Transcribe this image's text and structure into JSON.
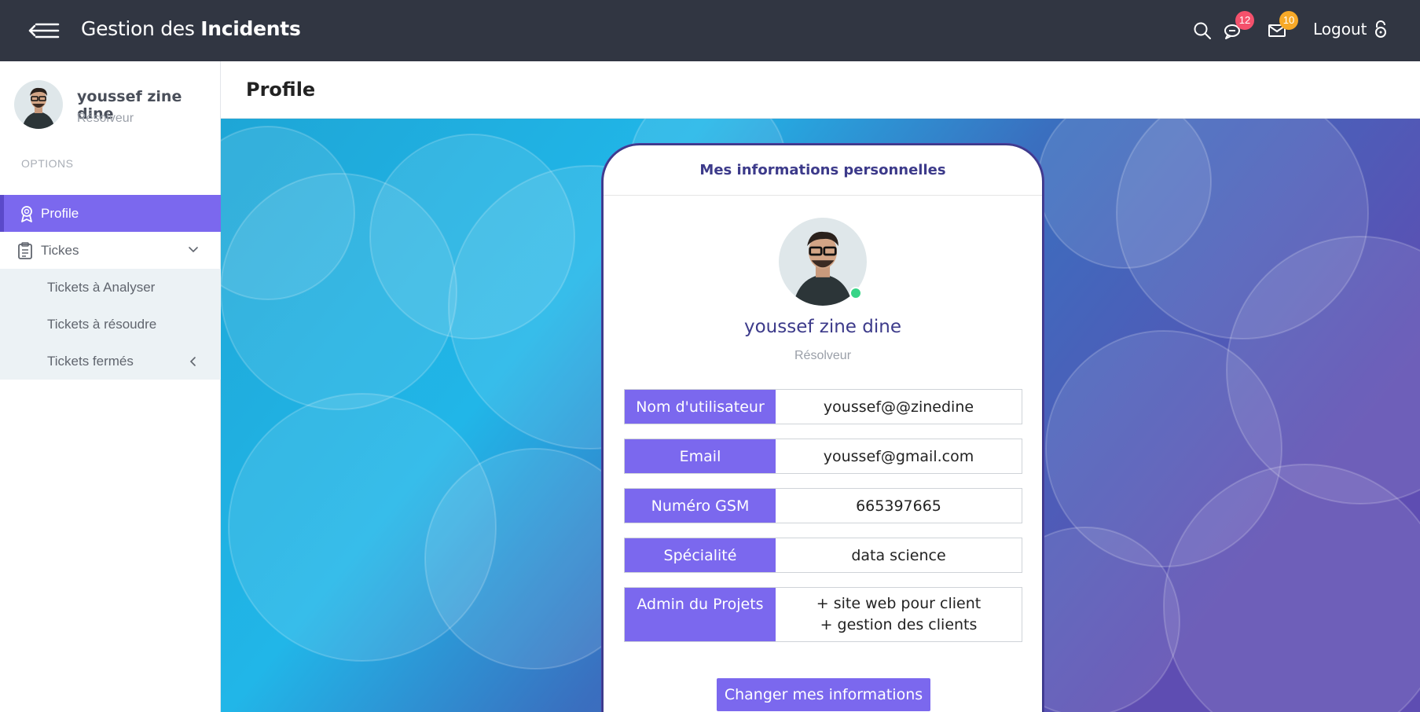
{
  "topbar": {
    "brand_prefix": "Gestion des ",
    "brand_strong": "Incidents",
    "notifications_count": "12",
    "messages_count": "10",
    "logout_label": "Logout"
  },
  "sidebar": {
    "user_name": "youssef zine dine",
    "user_role": "Résolveur",
    "options_label": "OPTIONS",
    "items": [
      {
        "label": "Profile",
        "icon": "award-icon"
      },
      {
        "label": "Tickes",
        "icon": "clipboard-icon"
      }
    ],
    "subitems": [
      {
        "label": "Tickets à Analyser"
      },
      {
        "label": "Tickets à résoudre"
      },
      {
        "label": "Tickets fermés"
      }
    ]
  },
  "page": {
    "title": "Profile"
  },
  "card": {
    "header": "Mes informations personnelles",
    "name": "youssef zine dine",
    "role": "Résolveur",
    "fields": [
      {
        "label": "Nom d'utilisateur",
        "value": "youssef@@zinedine"
      },
      {
        "label": "Email",
        "value": "youssef@gmail.com"
      },
      {
        "label": "Numéro GSM",
        "value": "665397665"
      },
      {
        "label": "Spécialité",
        "value": "data science"
      },
      {
        "label": "Admin du Projets",
        "values": [
          "+ site web pour client",
          "+ gestion des clients"
        ]
      }
    ],
    "button_label": "Changer mes informations"
  },
  "colors": {
    "topbar": "#313642",
    "accent": "#7b68ee",
    "card_title": "#3c3a8a",
    "badge_red": "#f4516c",
    "badge_orange": "#f7a928",
    "online": "#38d487"
  }
}
